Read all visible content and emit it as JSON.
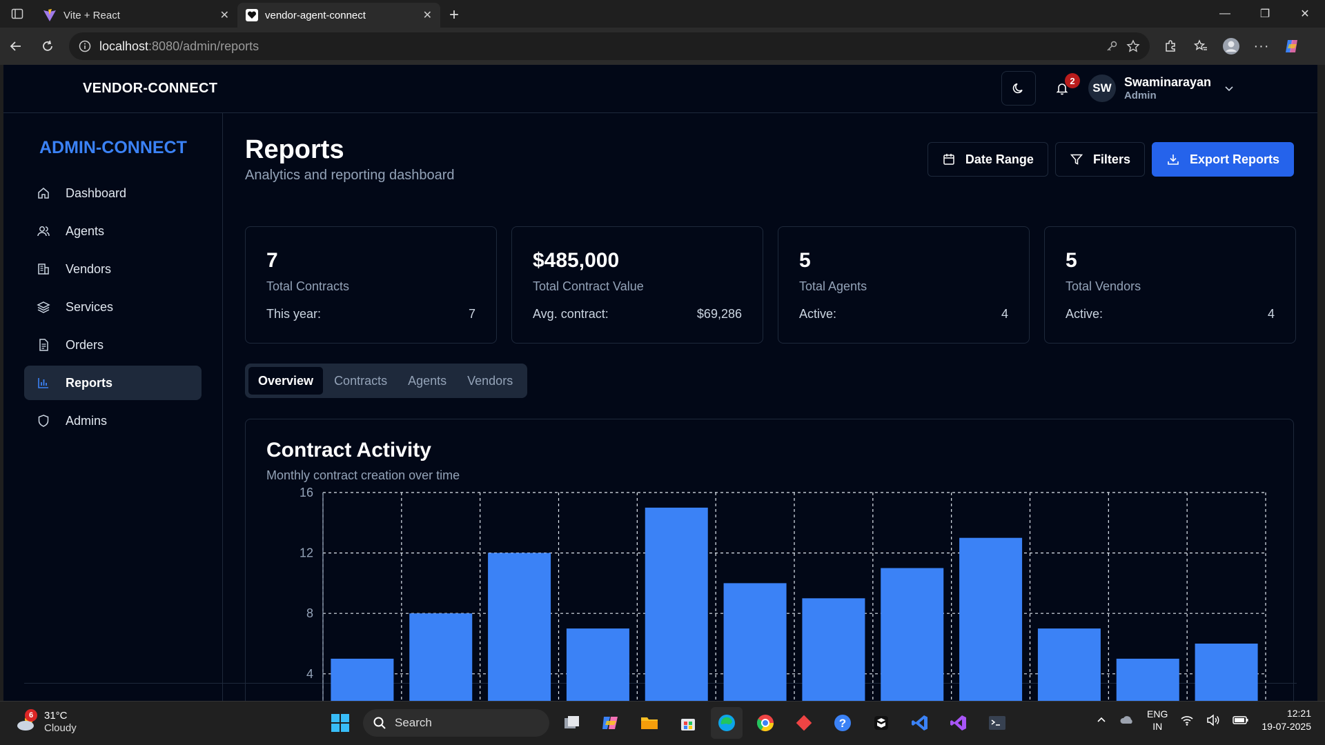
{
  "browser": {
    "tabs": [
      {
        "title": "Vite + React",
        "active": false
      },
      {
        "title": "vendor-agent-connect",
        "active": true
      }
    ],
    "url_host": "localhost",
    "url_path": ":8080/admin/reports"
  },
  "header": {
    "brand": "VENDOR-CONNECT",
    "notification_count": "2",
    "user_initials": "SW",
    "user_name": "Swaminarayan",
    "user_role": "Admin"
  },
  "sidebar": {
    "brand": "ADMIN-CONNECT",
    "items": [
      {
        "label": "Dashboard",
        "icon": "home-icon",
        "active": false
      },
      {
        "label": "Agents",
        "icon": "users-icon",
        "active": false
      },
      {
        "label": "Vendors",
        "icon": "building-icon",
        "active": false
      },
      {
        "label": "Services",
        "icon": "layers-icon",
        "active": false
      },
      {
        "label": "Orders",
        "icon": "file-text-icon",
        "active": false
      },
      {
        "label": "Reports",
        "icon": "bar-chart-icon",
        "active": true
      },
      {
        "label": "Admins",
        "icon": "shield-icon",
        "active": false
      }
    ]
  },
  "page": {
    "title": "Reports",
    "subtitle": "Analytics and reporting dashboard",
    "date_range_label": "Date Range",
    "filters_label": "Filters",
    "export_label": "Export Reports"
  },
  "stats": [
    {
      "value": "7",
      "label": "Total Contracts",
      "sub_label": "This year:",
      "sub_value": "7"
    },
    {
      "value": "$485,000",
      "label": "Total Contract Value",
      "sub_label": "Avg. contract:",
      "sub_value": "$69,286"
    },
    {
      "value": "5",
      "label": "Total Agents",
      "sub_label": "Active:",
      "sub_value": "4"
    },
    {
      "value": "5",
      "label": "Total Vendors",
      "sub_label": "Active:",
      "sub_value": "4"
    }
  ],
  "report_tabs": [
    {
      "label": "Overview",
      "active": true
    },
    {
      "label": "Contracts",
      "active": false
    },
    {
      "label": "Agents",
      "active": false
    },
    {
      "label": "Vendors",
      "active": false
    }
  ],
  "chart": {
    "title": "Contract Activity",
    "subtitle": "Monthly contract creation over time"
  },
  "chart_data": {
    "type": "bar",
    "title": "Contract Activity",
    "subtitle": "Monthly contract creation over time",
    "categories": [],
    "values": [
      5,
      8,
      12,
      7,
      15,
      10,
      9,
      11,
      13,
      7,
      5,
      6
    ],
    "ylim": [
      0,
      16
    ],
    "yticks": [
      4,
      8,
      12,
      16
    ],
    "grid": true,
    "bar_color": "#3b82f6"
  },
  "taskbar": {
    "weather_badge": "6",
    "temperature": "31°C",
    "condition": "Cloudy",
    "search_label": "Search",
    "lang_top": "ENG",
    "lang_bottom": "IN",
    "time": "12:21",
    "date": "19-07-2025"
  },
  "colors": {
    "accent": "#3b82f6",
    "primary_button": "#2563eb",
    "background": "#020817",
    "border": "#1e293b",
    "badge": "#b91c1c"
  }
}
